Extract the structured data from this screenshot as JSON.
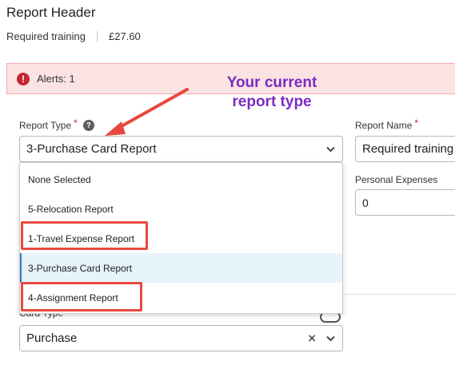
{
  "header": {
    "title": "Report Header",
    "report_name": "Required training",
    "amount": "£27.60"
  },
  "alerts": {
    "text": "Alerts: 1",
    "icon": "exclamation-icon",
    "color": "#c6262e"
  },
  "annotation": {
    "callout_line1": "Your current",
    "callout_line2": "report type",
    "callout_color": "#7b2cbf",
    "arrow_color": "#e8483f"
  },
  "report_type": {
    "label": "Report Type",
    "required_mark": "*",
    "help_icon": "?",
    "selected_value": "3-Purchase Card Report",
    "options": [
      {
        "label": "None Selected",
        "highlighted": false,
        "selected": false
      },
      {
        "label": "5-Relocation Report",
        "highlighted": false,
        "selected": false
      },
      {
        "label": "1-Travel Expense Report",
        "highlighted": true,
        "selected": false
      },
      {
        "label": "3-Purchase Card Report",
        "highlighted": false,
        "selected": true
      },
      {
        "label": "4-Assignment Report",
        "highlighted": true,
        "selected": false
      }
    ]
  },
  "report_name": {
    "label": "Report Name",
    "required_mark": "*",
    "value": "Required training"
  },
  "personal_expenses": {
    "label": "Personal Expenses",
    "value": "0"
  },
  "card_type": {
    "label": "Card Type",
    "value": "Purchase",
    "clear_icon": "✕"
  },
  "icons": {
    "chevron": "chevron-down-icon"
  }
}
